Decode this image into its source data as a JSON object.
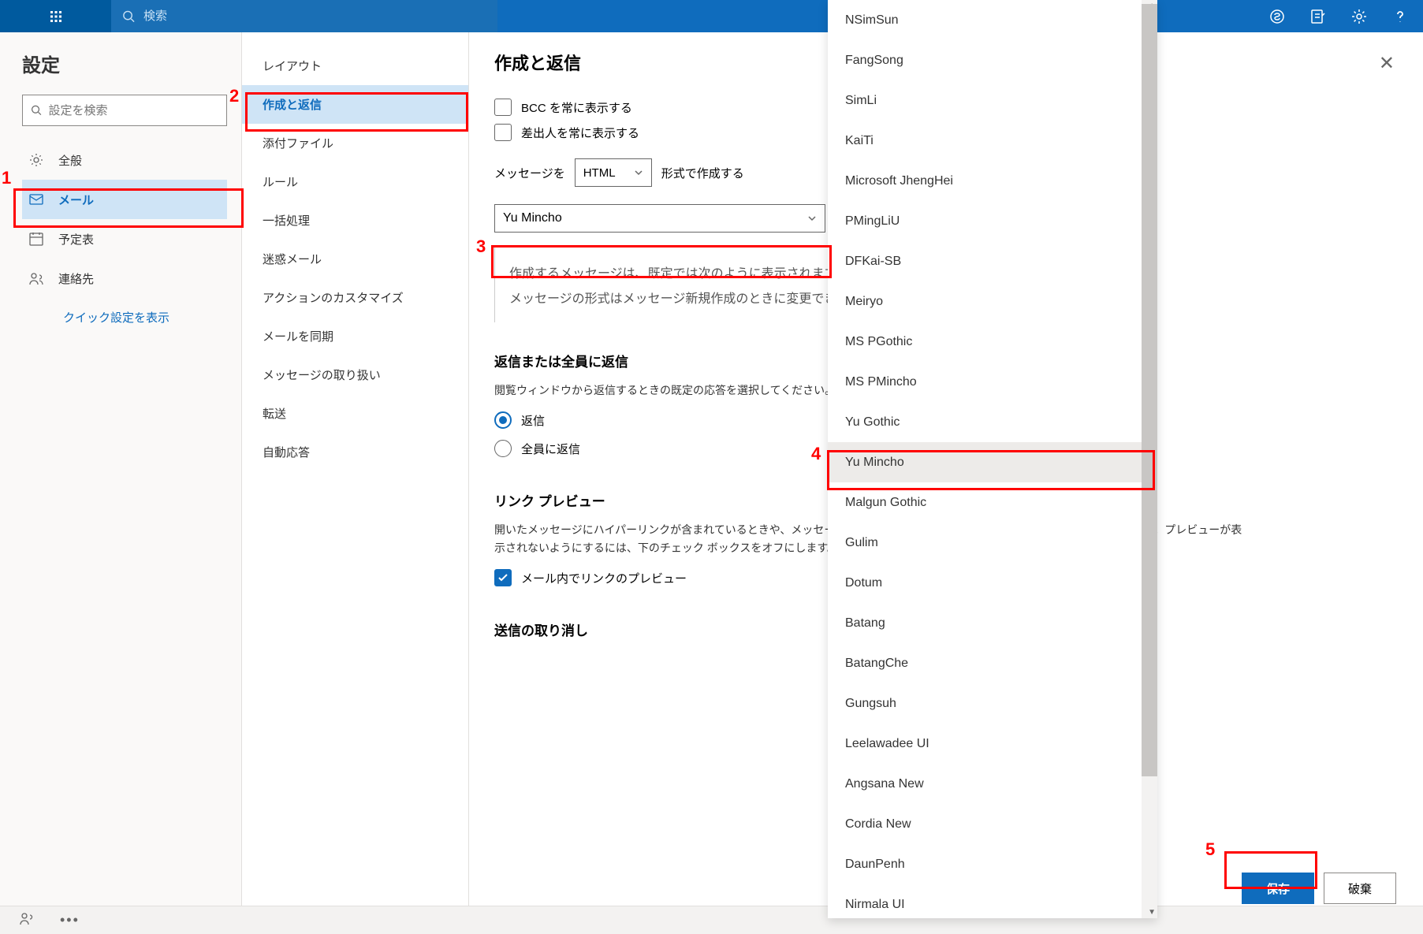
{
  "topbar": {
    "search_placeholder": "検索"
  },
  "sidebar1": {
    "title": "設定",
    "search_placeholder": "設定を検索",
    "items": [
      {
        "label": "全般"
      },
      {
        "label": "メール"
      },
      {
        "label": "予定表"
      },
      {
        "label": "連絡先"
      }
    ],
    "link": "クイック設定を表示"
  },
  "sidebar2": {
    "items": [
      {
        "label": "レイアウト"
      },
      {
        "label": "作成と返信"
      },
      {
        "label": "添付ファイル"
      },
      {
        "label": "ルール"
      },
      {
        "label": "一括処理"
      },
      {
        "label": "迷惑メール"
      },
      {
        "label": "アクションのカスタマイズ"
      },
      {
        "label": "メールを同期"
      },
      {
        "label": "メッセージの取り扱い"
      },
      {
        "label": "転送"
      },
      {
        "label": "自動応答"
      }
    ]
  },
  "content": {
    "title": "作成と返信",
    "chk_bcc": "BCC を常に表示する",
    "chk_from": "差出人を常に表示する",
    "msg_prefix": "メッセージを",
    "msg_format": "HTML",
    "msg_suffix": "形式で作成する",
    "font_selected": "Yu Mincho",
    "sample1": "作成するメッセージは、既定では次のように表示されます。",
    "sample2": "メッセージの形式はメッセージ新規作成のときに変更できます。",
    "h_reply": "返信または全員に返信",
    "p_reply": "閲覧ウィンドウから返信するときの既定の応答を選択してください。",
    "r_reply": "返信",
    "r_replyall": "全員に返信",
    "h_link": "リンク プレビュー",
    "p_link_a": "開いたメッセージにハイパーリンクが含まれているときや、メッセージ作成時にリンクを追加したときに、プレビューが挿入されます。プレビューが表",
    "p_link_b": "示されないようにするには、下のチェック ボックスをオフにします。",
    "chk_link": "メール内でリンクのプレビュー",
    "h_undo": "送信の取り消し"
  },
  "fonts": [
    "NSimSun",
    "FangSong",
    "SimLi",
    "KaiTi",
    "Microsoft JhengHei",
    "PMingLiU",
    "DFKai-SB",
    "Meiryo",
    "MS PGothic",
    "MS PMincho",
    "Yu Gothic",
    "Yu Mincho",
    "Malgun Gothic",
    "Gulim",
    "Dotum",
    "Batang",
    "BatangChe",
    "Gungsuh",
    "Leelawadee UI",
    "Angsana New",
    "Cordia New",
    "DaunPenh",
    "Nirmala UI"
  ],
  "footer": {
    "save": "保存",
    "discard": "破棄"
  },
  "annotations": {
    "n1": "1",
    "n2": "2",
    "n3": "3",
    "n4": "4",
    "n5": "5"
  }
}
